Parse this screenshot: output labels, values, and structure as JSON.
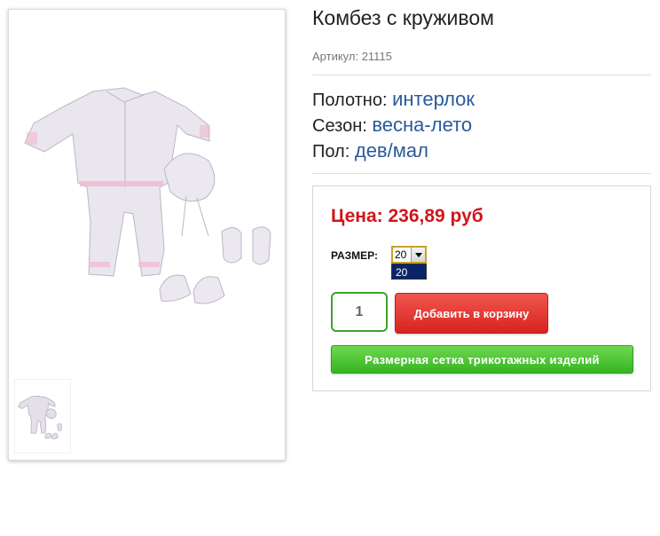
{
  "product": {
    "title": "Комбез с круживом",
    "sku": "Артикул: 21115",
    "attributes": [
      {
        "label": "Полотно:",
        "value": "интерлок"
      },
      {
        "label": "Сезон:",
        "value": "весна-лето"
      },
      {
        "label": "Пол:",
        "value": "дев/мал"
      }
    ]
  },
  "buy": {
    "price": "Цена: 236,89 руб",
    "size_label": "РАЗМЕР:",
    "size_selected": "20",
    "size_options": [
      "20"
    ],
    "quantity": "1",
    "add_to_cart": "Добавить в корзину",
    "size_chart": "Размерная сетка трикотажных изделий"
  },
  "colors": {
    "price": "#d0161b",
    "attr_value": "#2a5a9a",
    "add_to_cart": "#e4302b",
    "size_chart": "#46c430",
    "quantity_border": "#3aa32a"
  },
  "icons": {
    "select_arrow": "chevron-down-icon"
  }
}
